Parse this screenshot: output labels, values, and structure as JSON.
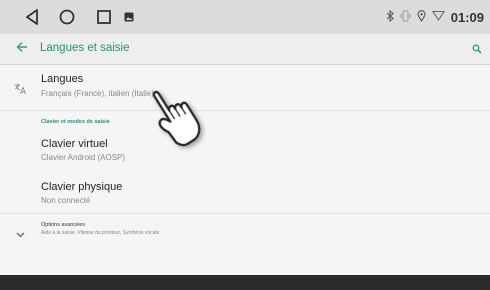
{
  "status": {
    "time": "01:09",
    "icons": [
      "bluetooth-icon",
      "vibrate-icon",
      "location-icon",
      "wifi-icon"
    ]
  },
  "nav": {
    "icons": [
      "back-triangle-icon",
      "home-circle-icon",
      "recents-square-icon",
      "gallery-icon"
    ]
  },
  "appbar": {
    "back_icon": "arrow-left-icon",
    "title": "Langues et saisie",
    "search_icon": "search-icon"
  },
  "langues": {
    "icon": "translate-icon",
    "title": "Langues",
    "subtitle": "Français (France), italien (Italie)"
  },
  "section_header": "Clavier et modes de saisie",
  "clavier_virtuel": {
    "title": "Clavier virtuel",
    "subtitle": "Clavier Android (AOSP)"
  },
  "clavier_physique": {
    "title": "Clavier physique",
    "subtitle": "Non connecté"
  },
  "options": {
    "icon": "chevron-down-icon",
    "title": "Options avancées",
    "subtitle": "Aide à la saisie, Vitesse du pointeur, Synthèse vocale"
  },
  "overlay": {
    "icon": "pointing-hand-icon"
  },
  "colors": {
    "accent": "#26907f",
    "statusbar": "#dcdcdc",
    "background": "#f5f5f5"
  }
}
